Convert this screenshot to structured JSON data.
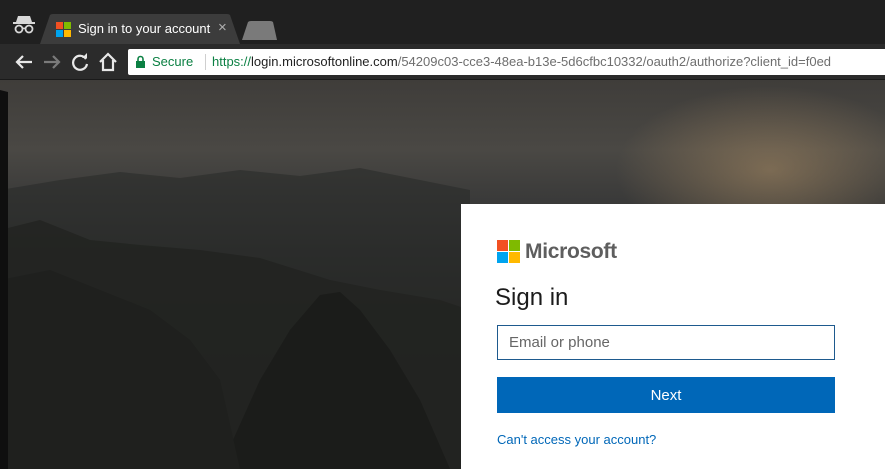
{
  "browser": {
    "tab": {
      "title": "Sign in to your account",
      "close": "×"
    },
    "omnibox": {
      "secure_label": "Secure",
      "url_scheme": "https://",
      "url_host": "login.microsoftonline.com",
      "url_path": "/54209c03-cce3-48ea-b13e-5d6cfbc10332/oauth2/authorize?client_id=f0ed"
    },
    "icons": [
      "incognito-icon",
      "back-arrow-icon",
      "forward-arrow-icon",
      "reload-icon",
      "home-icon",
      "lock-icon"
    ]
  },
  "login_card": {
    "brand": "Microsoft",
    "title": "Sign in",
    "email_placeholder": "Email or phone",
    "email_value": "",
    "next_label": "Next",
    "cant_access_link": "Can't access your account?"
  },
  "colors": {
    "accent": "#0067b8",
    "secure_green": "#0b8043",
    "ms_red": "#f25022",
    "ms_green": "#7fba00",
    "ms_blue": "#00a4ef",
    "ms_yellow": "#ffb900"
  }
}
